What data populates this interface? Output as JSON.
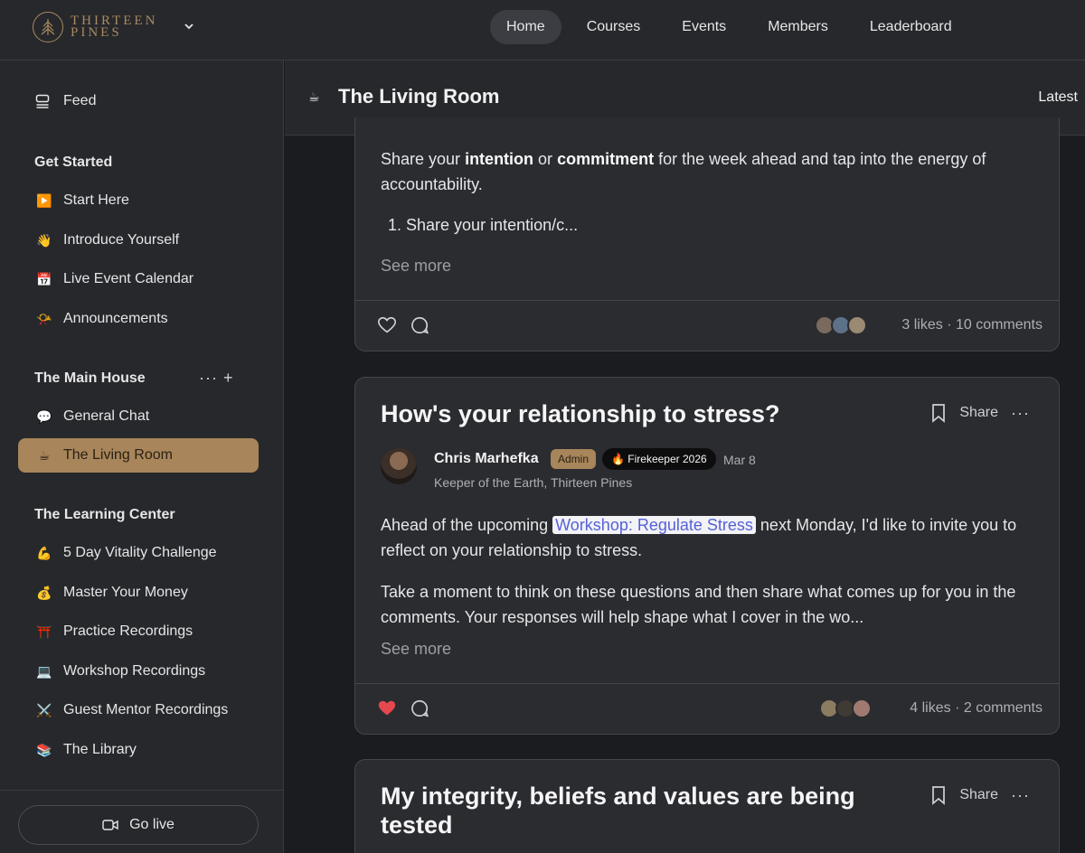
{
  "brand": {
    "line1": "THIRTEEN",
    "line2": "PINES"
  },
  "nav": [
    {
      "label": "Home",
      "active": true
    },
    {
      "label": "Courses",
      "active": false
    },
    {
      "label": "Events",
      "active": false
    },
    {
      "label": "Members",
      "active": false
    },
    {
      "label": "Leaderboard",
      "active": false
    }
  ],
  "sidebar": {
    "feed_label": "Feed",
    "sections": [
      {
        "heading": "Get Started",
        "items": [
          {
            "emoji": "▶️",
            "label": "Start Here"
          },
          {
            "emoji": "👋",
            "label": "Introduce Yourself"
          },
          {
            "emoji": "📅",
            "label": "Live Event Calendar"
          },
          {
            "emoji": "📯",
            "label": "Announcements"
          }
        ]
      },
      {
        "heading": "The Main House",
        "actions": "··· +",
        "items": [
          {
            "emoji": "💬",
            "label": "General Chat"
          },
          {
            "emoji": "☕",
            "label": "The Living Room",
            "active": true
          }
        ]
      },
      {
        "heading": "The Learning Center",
        "items": [
          {
            "emoji": "💪",
            "label": "5 Day Vitality Challenge"
          },
          {
            "emoji": "💰",
            "label": "Master Your Money"
          },
          {
            "emoji": "⛩️",
            "label": "Practice Recordings"
          },
          {
            "emoji": "💻",
            "label": "Workshop Recordings"
          },
          {
            "emoji": "⚔️",
            "label": "Guest Mentor Recordings"
          },
          {
            "emoji": "📚",
            "label": "The Library"
          }
        ]
      }
    ],
    "go_live_label": "Go live"
  },
  "space": {
    "icon": "☕",
    "title": "The Living Room",
    "sort_label": "Latest"
  },
  "posts": [
    {
      "body_1_pre": "Share your ",
      "body_1_b1": "intention",
      "body_1_mid": " or ",
      "body_1_b2": "commitment",
      "body_1_post": " for the week ahead and tap into the energy of accountability.",
      "list_item": "1. Share your intention/c...",
      "see_more": "See more",
      "stats": "3 likes · 10 comments",
      "liked": false,
      "accent_like": "#e5484d"
    },
    {
      "title": "How's your relationship to stress?",
      "share_label": "Share",
      "author": "Chris Marhefka",
      "badge_admin": "Admin",
      "badge_fire": "🔥 Firekeeper 2026",
      "date": "Mar 8",
      "author_subtitle": "Keeper of the Earth, Thirteen Pines",
      "p1_pre": "Ahead of the upcoming ",
      "p1_link": "Workshop: Regulate Stress",
      "p1_post": " next Monday, I'd like to invite you to reflect on your relationship to stress.",
      "p2": "Take a moment to think on these questions and then share what comes up for you in the comments. Your responses will help shape what I cover in the wo...",
      "see_more": "See more",
      "stats": "4 likes · 2 comments",
      "liked": true
    },
    {
      "title": "My integrity, beliefs and values are being tested",
      "share_label": "Share"
    }
  ]
}
